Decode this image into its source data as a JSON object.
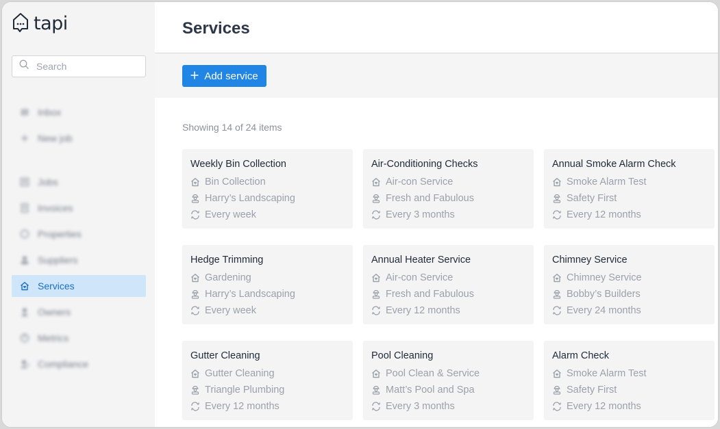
{
  "app": {
    "logo_text": "tapi"
  },
  "search": {
    "placeholder": "Search"
  },
  "sidebar": {
    "items": [
      {
        "label": "Inbox",
        "icon": "hash-icon",
        "blurred": true
      },
      {
        "label": "New job",
        "icon": "plus-icon",
        "blurred": true
      },
      {
        "label": "Jobs",
        "icon": "jobs-icon",
        "blurred": true
      },
      {
        "label": "Invoices",
        "icon": "invoice-icon",
        "blurred": true
      },
      {
        "label": "Properties",
        "icon": "property-icon",
        "blurred": true
      },
      {
        "label": "Suppliers",
        "icon": "supplier-icon",
        "blurred": true
      },
      {
        "label": "Services",
        "icon": "home-heart-icon",
        "blurred": false,
        "active": true
      },
      {
        "label": "Owners",
        "icon": "owner-icon",
        "blurred": true
      },
      {
        "label": "Metrics",
        "icon": "metrics-icon",
        "blurred": true
      },
      {
        "label": "Compliance",
        "icon": "compliance-icon",
        "blurred": true
      }
    ]
  },
  "page": {
    "title": "Services",
    "add_button_label": "Add service",
    "showing_text": "Showing 14 of 24 items"
  },
  "colors": {
    "accent": "#2185e6",
    "active_nav_bg": "#cfe5f9",
    "active_nav_text": "#1a6fc4",
    "card_bg": "#f4f4f5",
    "muted_text": "#9aa1ab"
  },
  "services": [
    {
      "title": "Weekly Bin Collection",
      "type": "Bin Collection",
      "supplier": "Harry’s Landscaping",
      "frequency": "Every week"
    },
    {
      "title": "Air-Conditioning Checks",
      "type": "Air-con Service",
      "supplier": "Fresh and Fabulous",
      "frequency": "Every 3 months"
    },
    {
      "title": "Annual Smoke Alarm Check",
      "type": "Smoke Alarm Test",
      "supplier": "Safety First",
      "frequency": "Every 12 months"
    },
    {
      "title": "Hedge Trimming",
      "type": "Gardening",
      "supplier": "Harry’s Landscaping",
      "frequency": "Every week"
    },
    {
      "title": "Annual Heater Service",
      "type": "Air-con Service",
      "supplier": "Fresh and Fabulous",
      "frequency": "Every 12 months"
    },
    {
      "title": "Chimney Service",
      "type": "Chimney Service",
      "supplier": "Bobby’s Builders",
      "frequency": "Every 24 months"
    },
    {
      "title": "Gutter Cleaning",
      "type": "Gutter Cleaning",
      "supplier": "Triangle Plumbing",
      "frequency": "Every 12 months"
    },
    {
      "title": "Pool Cleaning",
      "type": "Pool Clean & Service",
      "supplier": "Matt’s Pool and Spa",
      "frequency": "Every 3 months"
    },
    {
      "title": "Alarm Check",
      "type": "Smoke Alarm Test",
      "supplier": "Safety First",
      "frequency": "Every 12 months"
    }
  ]
}
